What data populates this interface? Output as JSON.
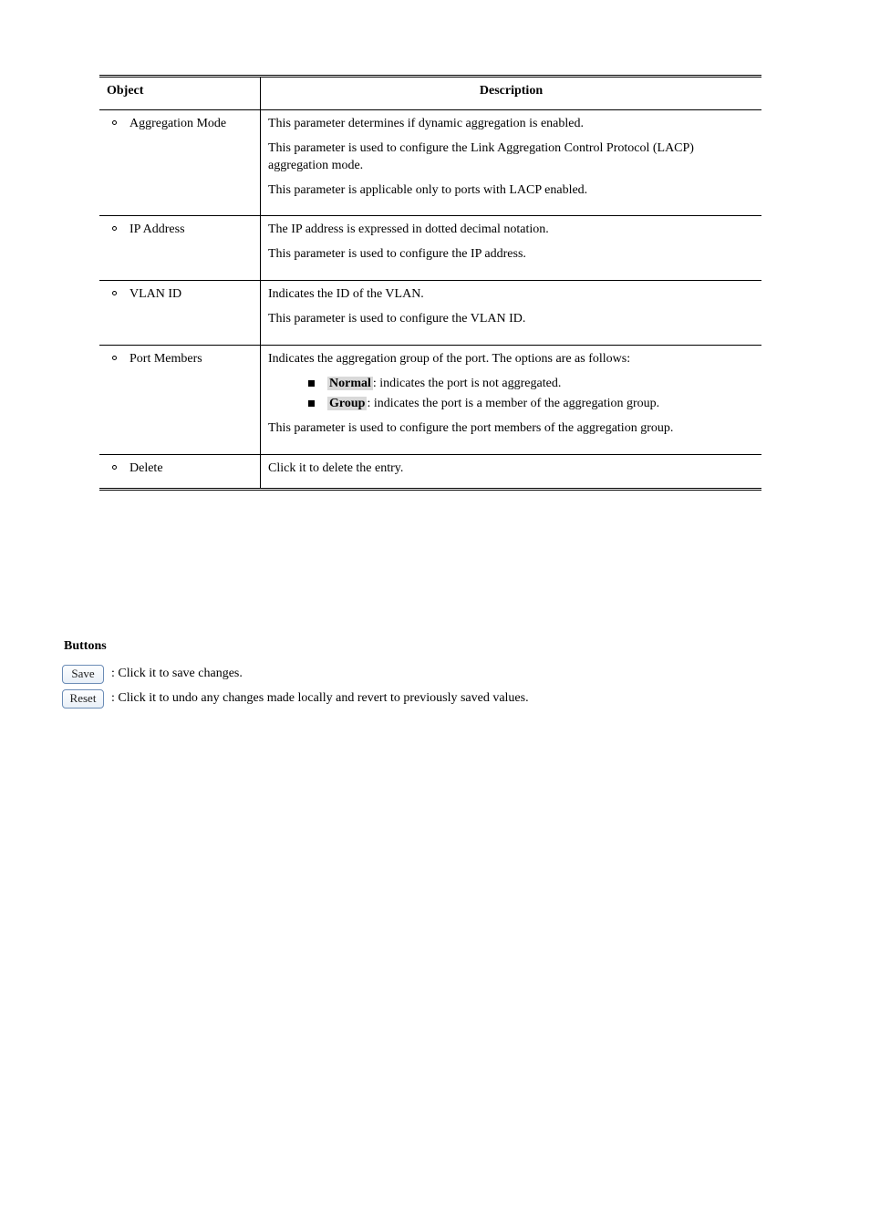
{
  "table": {
    "headers": {
      "left": "Object",
      "right": "Description"
    },
    "rows": [
      {
        "label": "Aggregation Mode",
        "desc_lines": [
          "This parameter determines if dynamic aggregation is enabled.",
          "This parameter is used to configure the Link Aggregation Control Protocol (LACP) aggregation mode.",
          "This parameter is applicable only to ports with LACP enabled."
        ]
      },
      {
        "label": "IP Address",
        "desc_lines": [
          "The IP address is expressed in dotted decimal notation.",
          "This parameter is used to configure the IP address."
        ]
      },
      {
        "label": "VLAN ID",
        "desc_lines": [
          "Indicates the ID of the VLAN.",
          "This parameter is used to configure the VLAN ID."
        ]
      },
      {
        "label": "Port Members",
        "desc_top": "Indicates the aggregation group of the port. The options are as follows:",
        "bullets": [
          {
            "hl": "Normal",
            "rest": ": indicates the port is not aggregated."
          },
          {
            "hl": "Group",
            "rest": ": indicates the port is a member of the aggregation group."
          }
        ],
        "desc_bottom": "This parameter is used to configure the port members of the aggregation group."
      },
      {
        "label": "Delete",
        "desc_lines": [
          "Click it to delete the entry."
        ]
      }
    ]
  },
  "buttons_section": {
    "heading": "Buttons",
    "save": {
      "img_text": "Save",
      "text": ": Click it to save changes.",
      "name": "save-button"
    },
    "reset": {
      "img_text": "Reset",
      "text": ": Click it to undo any changes made locally and revert to previously saved values.",
      "name": "reset-button"
    }
  }
}
